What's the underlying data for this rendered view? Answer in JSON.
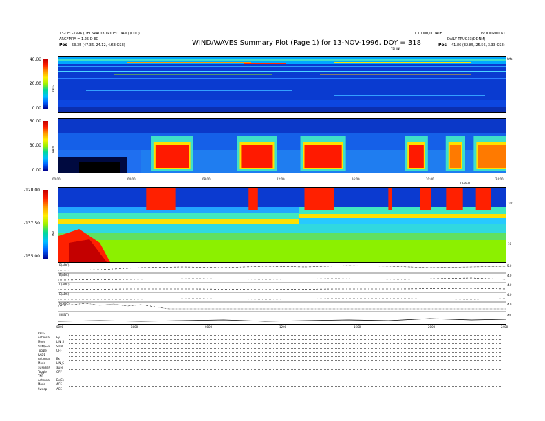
{
  "header": {
    "title": "WIND/WAVES Summary Plot (Page 1) for 13-NOV-1996, DOY = 318",
    "left_line1": "13-DEC-1996 (DECSPAT03 TRIDED DAW) (UTC)",
    "left_line2": "ARGFMRA = 1.25 D EC",
    "left_line3_prefix": "Pos",
    "left_line3": "53.35 (47.36, 24.12, 4.63 GSE)",
    "right_line1": "1.10 MB/D DATE",
    "right_line2": "DAILY TRUG33(DDNM)",
    "right_line3_prefix": "Pos",
    "right_line3": "41.86 (32.85, 25.56, 3.33 GSE)",
    "far_right": "L06/TODR=0.61",
    "sub_right": "TELMK"
  },
  "panels": {
    "rad2": {
      "label": "RAD2",
      "ticks": [
        "40.00",
        "20.00",
        "0.00"
      ]
    },
    "rad1": {
      "label": "RAD1",
      "ticks": [
        "50.00",
        "30.00",
        "0.00"
      ],
      "right_tick": "DFRAD"
    },
    "tnr": {
      "label": "TNR",
      "ticks": [
        "-120.00",
        "-137.50",
        "-155.00"
      ],
      "right_ticks": [
        "100",
        "10"
      ]
    },
    "time_axis1": [
      "00:00",
      "04:00",
      "08:00",
      "12:00",
      "16:00",
      "20:00",
      "24:00"
    ],
    "time_axis1_right": "kHz",
    "time_axis2": [
      "0000",
      "0400",
      "0800",
      "1200",
      "1600",
      "2000",
      "2400"
    ]
  },
  "line_plots": [
    {
      "label": "B(ADC)",
      "right": "5.0"
    },
    {
      "label": "E(ADC)",
      "right": "4.0"
    },
    {
      "label": "C(ADC)",
      "right": "4.0"
    },
    {
      "label": "E(ADC)",
      "right": "4.0"
    },
    {
      "label": "N(ADC)",
      "right": "4.0"
    },
    {
      "label": "|B|(NT)",
      "right": "40"
    }
  ],
  "info_rows": [
    {
      "k": "RAD2",
      "v": ""
    },
    {
      "k": "Antenna",
      "v": "Ey"
    },
    {
      "k": "Mode",
      "v": "LIN_S"
    },
    {
      "k": "SUM/SEP",
      "v": "SUM"
    },
    {
      "k": "Toggle",
      "v": "OFF"
    },
    {
      "k": "RAD1",
      "v": ""
    },
    {
      "k": "Antenna",
      "v": "Ex"
    },
    {
      "k": "Mode",
      "v": "LIN_S"
    },
    {
      "k": "SUM/SEP",
      "v": "SUM"
    },
    {
      "k": "Toggle",
      "v": "OFF"
    },
    {
      "k": "TNR",
      "v": ""
    },
    {
      "k": "Antenna",
      "v": "Ex/Ey"
    },
    {
      "k": "Mode",
      "v": "ACE"
    },
    {
      "k": "Sweep",
      "v": "ACE"
    }
  ],
  "chart_data": {
    "type": "heatmap",
    "title": "WIND/WAVES Summary Plot (Page 1) for 13-NOV-1996, DOY = 318",
    "x_range_hours": [
      0,
      24
    ],
    "bursts_rad1": [
      {
        "start": 5.2,
        "end": 7.0,
        "intensity": "high"
      },
      {
        "start": 9.8,
        "end": 11.5,
        "intensity": "high"
      },
      {
        "start": 13.2,
        "end": 15.2,
        "intensity": "high"
      },
      {
        "start": 18.8,
        "end": 19.6,
        "intensity": "high"
      },
      {
        "start": 21.0,
        "end": 21.6,
        "intensity": "medium"
      },
      {
        "start": 22.5,
        "end": 24.0,
        "intensity": "medium"
      }
    ],
    "bursts_tnr": [
      {
        "start": 4.7,
        "end": 6.3
      },
      {
        "start": 10.2,
        "end": 10.7
      },
      {
        "start": 13.2,
        "end": 14.8
      },
      {
        "start": 17.7,
        "end": 17.9
      },
      {
        "start": 19.4,
        "end": 20.0
      },
      {
        "start": 20.8,
        "end": 21.7
      },
      {
        "start": 22.4,
        "end": 23.2
      }
    ],
    "colorbar_range_rad2": [
      0,
      40
    ],
    "colorbar_range_rad1": [
      0,
      50
    ],
    "colorbar_range_tnr": [
      -155,
      -120
    ]
  }
}
